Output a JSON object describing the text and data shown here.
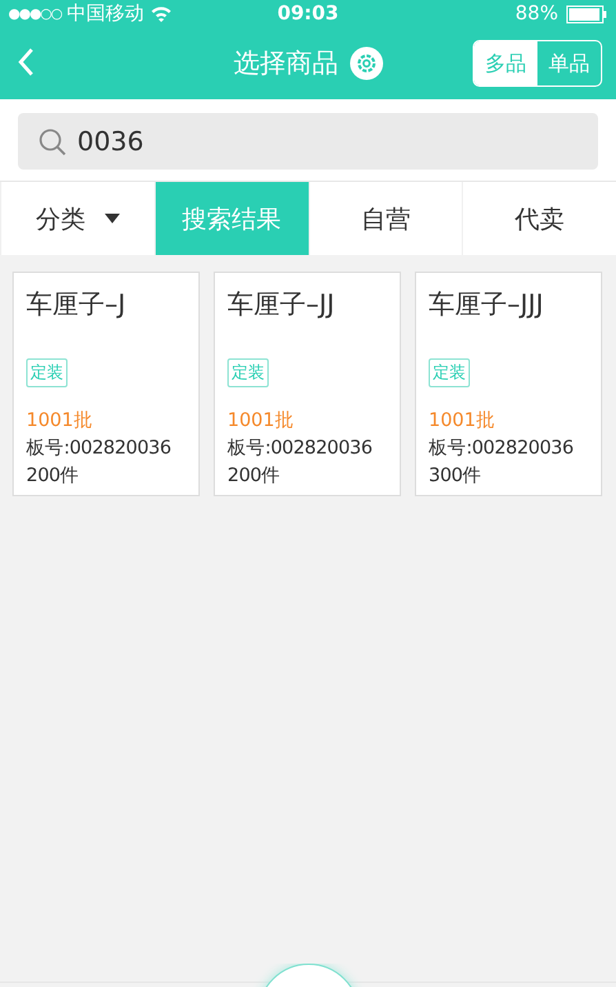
{
  "status_bar": {
    "signal_dots": "●●●○○",
    "carrier": "中国移动",
    "time": "09:03",
    "battery": "88%"
  },
  "nav": {
    "title": "选择商品",
    "modes": [
      {
        "label": "多品",
        "selected": true
      },
      {
        "label": "单品",
        "selected": false
      }
    ]
  },
  "search": {
    "value": "0036"
  },
  "tabs": [
    {
      "label": "分类",
      "kind": "dropdown",
      "selected": false
    },
    {
      "label": "搜索结果",
      "kind": "tab",
      "selected": true
    },
    {
      "label": "自营",
      "kind": "tab",
      "selected": false
    },
    {
      "label": "代卖",
      "kind": "tab",
      "selected": false
    }
  ],
  "products": [
    {
      "name": "车厘子–J",
      "tag": "定装",
      "batch": "1001批",
      "board": "板号:002820036",
      "quantity": "200件"
    },
    {
      "name": "车厘子–JJ",
      "tag": "定装",
      "batch": "1001批",
      "board": "板号:002820036",
      "quantity": "200件"
    },
    {
      "name": "车厘子–JJJ",
      "tag": "定装",
      "batch": "1001批",
      "board": "板号:002820036",
      "quantity": "300件"
    }
  ]
}
